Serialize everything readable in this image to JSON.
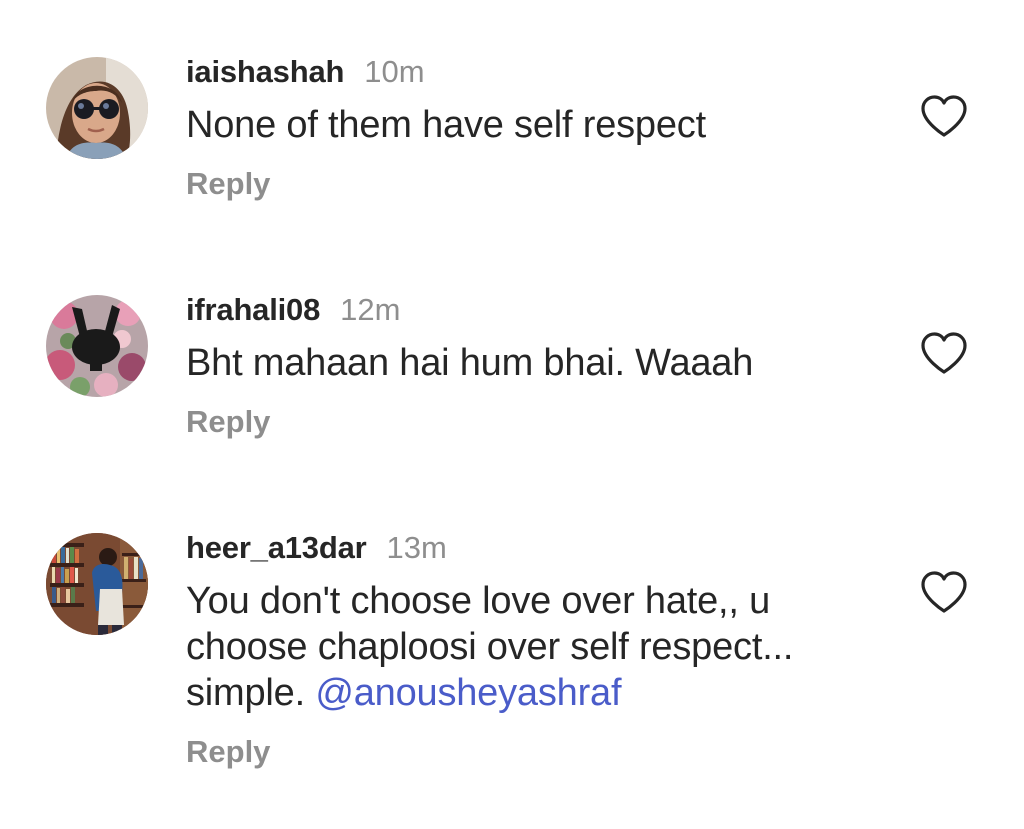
{
  "comments": [
    {
      "username": "iaishashah",
      "time": "10m",
      "text": "None of them have self respect",
      "mention": "",
      "reply_label": "Reply",
      "avatar_icon": "user-photo-sunglasses",
      "like_icon": "heart-outline-icon"
    },
    {
      "username": "ifrahali08",
      "time": "12m",
      "text": "Bht mahaan hai hum bhai. Waaah",
      "mention": "",
      "reply_label": "Reply",
      "avatar_icon": "user-photo-flowers",
      "like_icon": "heart-outline-icon"
    },
    {
      "username": "heer_a13dar",
      "time": "13m",
      "text_lines": [
        "You don't choose love over hate,, u",
        "choose chaploosi over self respect...",
        "simple. "
      ],
      "mention": "@anousheyashraf",
      "reply_label": "Reply",
      "avatar_icon": "user-photo-bookstore",
      "like_icon": "heart-outline-icon"
    }
  ],
  "colors": {
    "username": "#262626",
    "secondary": "#8e8e8e",
    "mention": "#4a5cc9",
    "background": "#ffffff"
  }
}
